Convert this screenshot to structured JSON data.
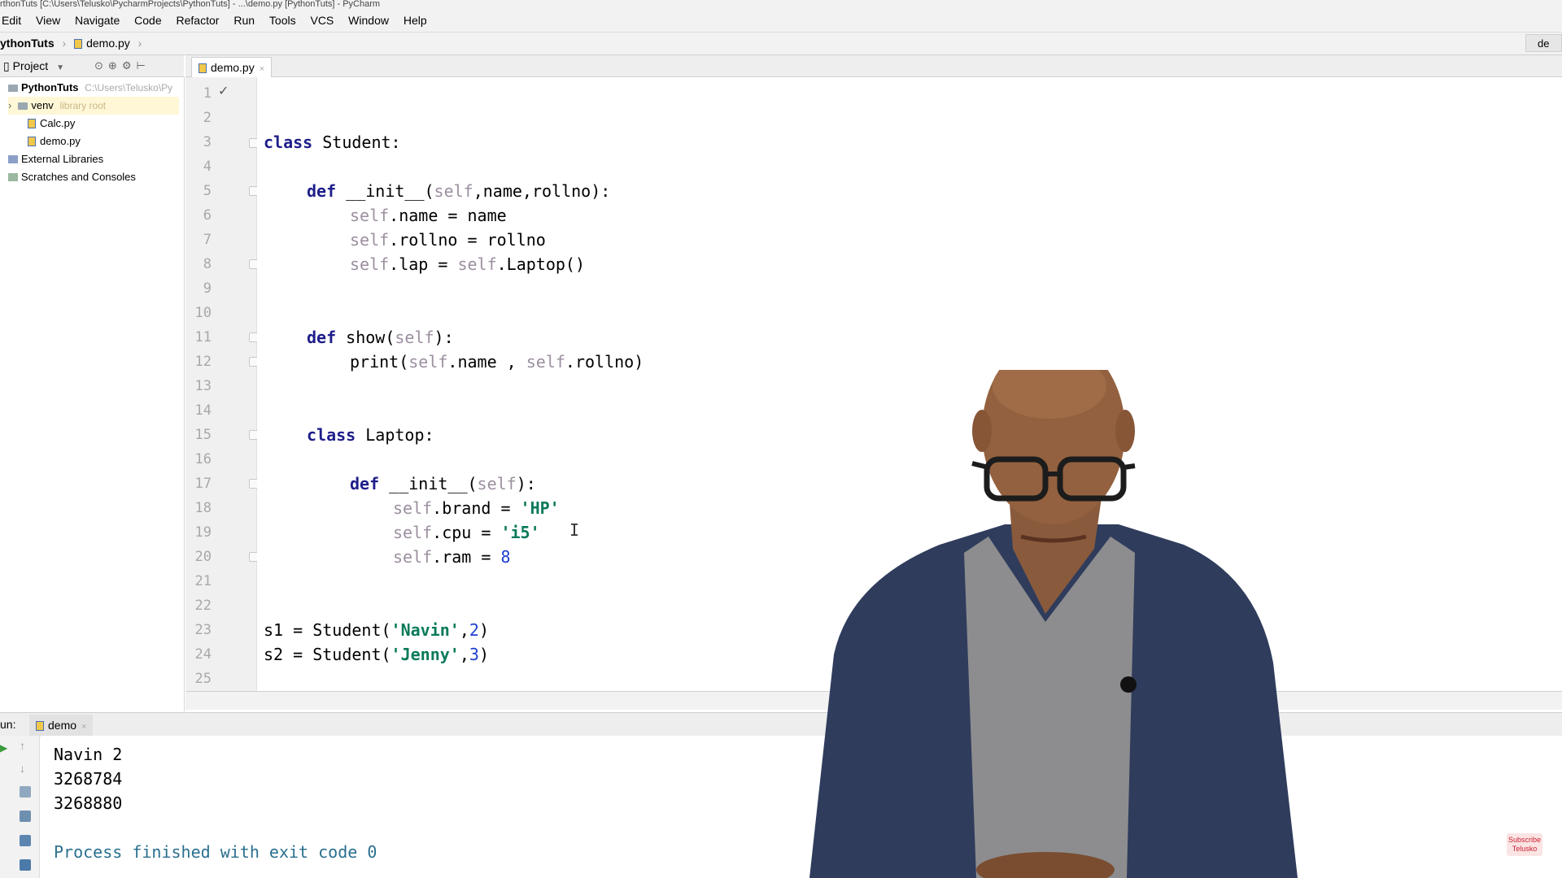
{
  "window": {
    "title": "rthonTuts [C:\\Users\\Telusko\\PycharmProjects\\PythonTuts] - ...\\demo.py [PythonTuts] - PyCharm"
  },
  "menu": [
    "Edit",
    "View",
    "Navigate",
    "Code",
    "Refactor",
    "Run",
    "Tools",
    "VCS",
    "Window",
    "Help"
  ],
  "breadcrumb": {
    "project": "ythonTuts",
    "file": "demo.py",
    "right_tab": "de"
  },
  "project_panel": {
    "header": "Project",
    "items": [
      {
        "label": "PythonTuts",
        "hint": "C:\\Users\\Telusko\\Py"
      },
      {
        "label": "venv",
        "hint": "library root"
      },
      {
        "label": "Calc.py",
        "hint": ""
      },
      {
        "label": "demo.py",
        "hint": ""
      },
      {
        "label": "External Libraries",
        "hint": ""
      },
      {
        "label": "Scratches and Consoles",
        "hint": ""
      }
    ]
  },
  "editor": {
    "tab": "demo.py",
    "line_numbers": [
      "1",
      "2",
      "3",
      "4",
      "5",
      "6",
      "7",
      "8",
      "9",
      "10",
      "11",
      "12",
      "13",
      "14",
      "15",
      "16",
      "17",
      "18",
      "19",
      "20",
      "21",
      "22",
      "23",
      "24",
      "25"
    ],
    "tokens": {
      "class": "class",
      "student": " Student:",
      "def": "def",
      "init": " __init__(",
      "self": "self",
      "init_args": ",name,rollno):",
      "self_name": ".name = name",
      "self_rollno": ".rollno = rollno",
      "self_lap": ".lap = ",
      "laptop_call": ".Laptop()",
      "show": " show(",
      "close_colon": "):",
      "print": "print(",
      "dot_name": ".name , ",
      "dot_rollno": ".rollno)",
      "laptop": " Laptop:",
      "init_self": " __init__(",
      "brand": ".brand = ",
      "hp": "'HP'",
      "cpu": ".cpu = ",
      "i5": "'i5'",
      "ram": ".ram = ",
      "eight": "8",
      "s1": "s1 = Student(",
      "navin": "'Navin'",
      "comma2": ",",
      "two": "2",
      "close": ")",
      "s2": "s2 = Student(",
      "jenny": "'Jenny'",
      "three": "3"
    }
  },
  "run": {
    "label": "un:",
    "tab": "demo",
    "output": [
      "Navin 2",
      "3268784",
      "3268880",
      "",
      "Process finished with exit code 0"
    ]
  },
  "overlay": {
    "subscribe": "Subscribe Telusko"
  },
  "colors": {
    "keyword": "#1d1d8a",
    "self": "#9c8fa0",
    "string": "#0a7a5a",
    "number": "#1f3fd0",
    "process": "#2a6f8e"
  }
}
